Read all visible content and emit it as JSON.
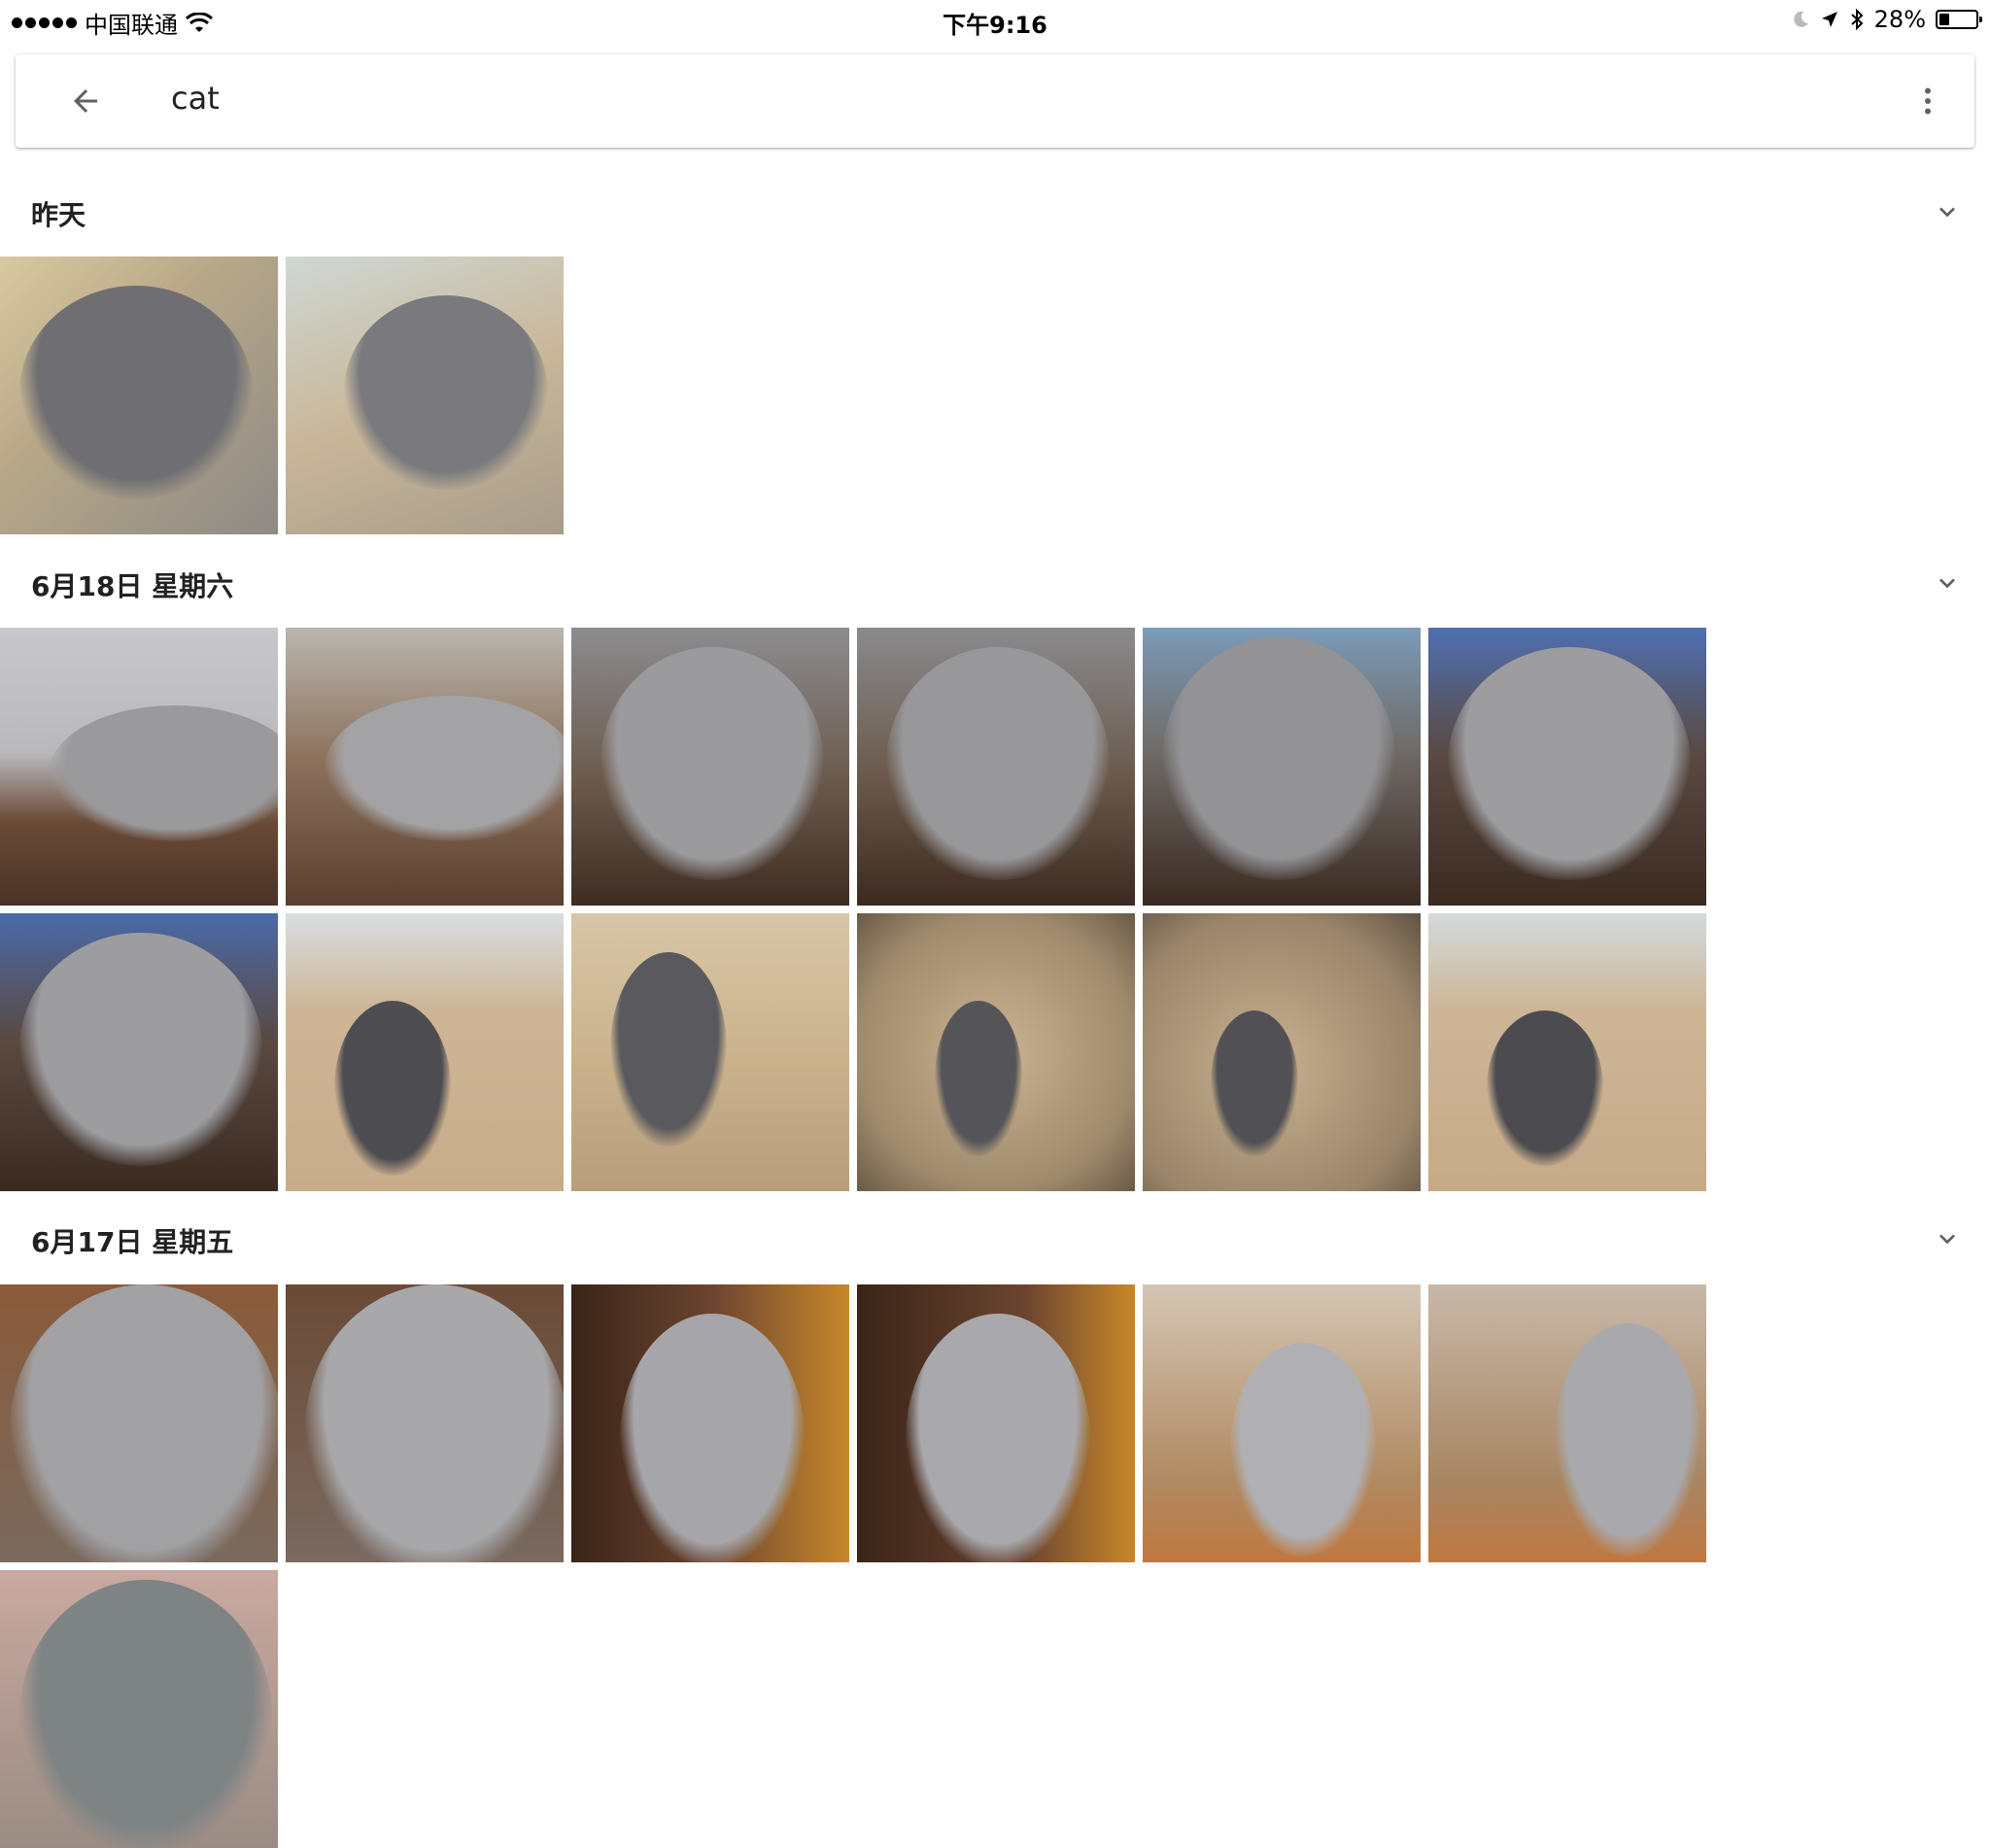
{
  "status_bar": {
    "carrier": "中国联通",
    "time": "下午9:16",
    "battery": "28%",
    "battery_level": 0.28
  },
  "search": {
    "query": "cat"
  },
  "sections": [
    {
      "title": "昨天",
      "photo_count": 2
    },
    {
      "title": "6月18日 星期六",
      "photo_count": 12
    },
    {
      "title": "6月17日 星期五",
      "photo_count": 7
    }
  ],
  "colors": {
    "background": "#ffffff",
    "text": "#212121",
    "icon": "#616161"
  }
}
